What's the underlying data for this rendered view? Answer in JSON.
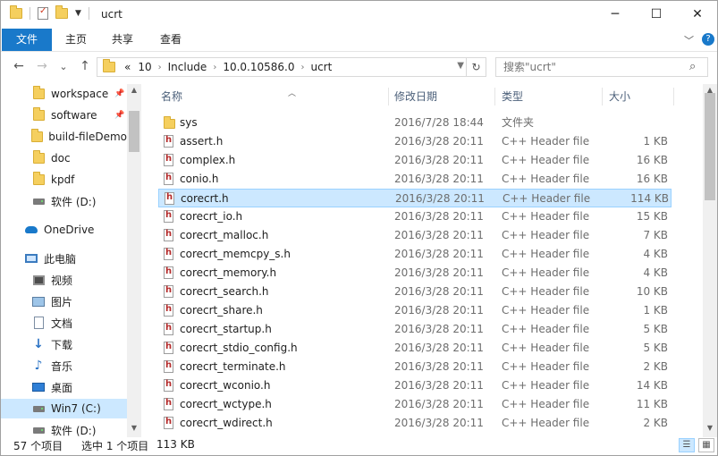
{
  "window": {
    "title": "ucrt",
    "minimize": "─",
    "maximize": "☐",
    "close": "✕"
  },
  "ribbon": {
    "tabs": [
      "文件",
      "主页",
      "共享",
      "查看"
    ],
    "collapse": "﹀",
    "help": "?"
  },
  "address": {
    "crumbs": [
      "«",
      "10",
      "Include",
      "10.0.10586.0",
      "ucrt"
    ],
    "chevron": "›"
  },
  "search": {
    "placeholder": "搜索\"ucrt\""
  },
  "nav_glyphs": {
    "back": "←",
    "forward": "→",
    "recent": "⌄",
    "up": "↑",
    "refresh": "↻",
    "search": "⌕"
  },
  "sidebar": {
    "items": [
      {
        "label": "workspace",
        "icon": "folder-icon",
        "pinned": true
      },
      {
        "label": "software",
        "icon": "folder-icon",
        "pinned": true
      },
      {
        "label": "build-fileDemo",
        "icon": "folder-icon"
      },
      {
        "label": "doc",
        "icon": "folder-icon"
      },
      {
        "label": "kpdf",
        "icon": "folder-icon"
      },
      {
        "label": "软件 (D:)",
        "icon": "drive-icon"
      },
      {
        "label": "OneDrive",
        "icon": "cloud-icon"
      },
      {
        "label": "此电脑",
        "icon": "computer-icon"
      },
      {
        "label": "视频",
        "icon": "video-icon"
      },
      {
        "label": "图片",
        "icon": "pictures-icon"
      },
      {
        "label": "文档",
        "icon": "documents-icon"
      },
      {
        "label": "下载",
        "icon": "download-icon"
      },
      {
        "label": "音乐",
        "icon": "music-icon"
      },
      {
        "label": "桌面",
        "icon": "desktop-icon"
      },
      {
        "label": "Win7 (C:)",
        "icon": "drive-icon",
        "selected": true
      },
      {
        "label": "软件 (D:)",
        "icon": "drive-icon"
      }
    ],
    "pin_glyph": "📌"
  },
  "columns": {
    "name": "名称",
    "date": "修改日期",
    "type": "类型",
    "size": "大小"
  },
  "files": [
    {
      "name": "sys",
      "date": "2016/7/28 18:44",
      "type": "文件夹",
      "size": "",
      "kind": "folder"
    },
    {
      "name": "assert.h",
      "date": "2016/3/28 20:11",
      "type": "C++ Header file",
      "size": "1 KB",
      "kind": "header"
    },
    {
      "name": "complex.h",
      "date": "2016/3/28 20:11",
      "type": "C++ Header file",
      "size": "16 KB",
      "kind": "header"
    },
    {
      "name": "conio.h",
      "date": "2016/3/28 20:11",
      "type": "C++ Header file",
      "size": "16 KB",
      "kind": "header"
    },
    {
      "name": "corecrt.h",
      "date": "2016/3/28 20:11",
      "type": "C++ Header file",
      "size": "114 KB",
      "kind": "header",
      "selected": true
    },
    {
      "name": "corecrt_io.h",
      "date": "2016/3/28 20:11",
      "type": "C++ Header file",
      "size": "15 KB",
      "kind": "header"
    },
    {
      "name": "corecrt_malloc.h",
      "date": "2016/3/28 20:11",
      "type": "C++ Header file",
      "size": "7 KB",
      "kind": "header"
    },
    {
      "name": "corecrt_memcpy_s.h",
      "date": "2016/3/28 20:11",
      "type": "C++ Header file",
      "size": "4 KB",
      "kind": "header"
    },
    {
      "name": "corecrt_memory.h",
      "date": "2016/3/28 20:11",
      "type": "C++ Header file",
      "size": "4 KB",
      "kind": "header"
    },
    {
      "name": "corecrt_search.h",
      "date": "2016/3/28 20:11",
      "type": "C++ Header file",
      "size": "10 KB",
      "kind": "header"
    },
    {
      "name": "corecrt_share.h",
      "date": "2016/3/28 20:11",
      "type": "C++ Header file",
      "size": "1 KB",
      "kind": "header"
    },
    {
      "name": "corecrt_startup.h",
      "date": "2016/3/28 20:11",
      "type": "C++ Header file",
      "size": "5 KB",
      "kind": "header"
    },
    {
      "name": "corecrt_stdio_config.h",
      "date": "2016/3/28 20:11",
      "type": "C++ Header file",
      "size": "5 KB",
      "kind": "header"
    },
    {
      "name": "corecrt_terminate.h",
      "date": "2016/3/28 20:11",
      "type": "C++ Header file",
      "size": "2 KB",
      "kind": "header"
    },
    {
      "name": "corecrt_wconio.h",
      "date": "2016/3/28 20:11",
      "type": "C++ Header file",
      "size": "14 KB",
      "kind": "header"
    },
    {
      "name": "corecrt_wctype.h",
      "date": "2016/3/28 20:11",
      "type": "C++ Header file",
      "size": "11 KB",
      "kind": "header"
    },
    {
      "name": "corecrt_wdirect.h",
      "date": "2016/3/28 20:11",
      "type": "C++ Header file",
      "size": "2 KB",
      "kind": "header"
    }
  ],
  "status": {
    "count": "57 个项目",
    "selected": "选中 1 个项目",
    "size": "113 KB"
  },
  "colors": {
    "accent": "#1979ca",
    "selection": "#cce8ff",
    "selection_border": "#99d1ff",
    "folder": "#f5cf5e"
  }
}
